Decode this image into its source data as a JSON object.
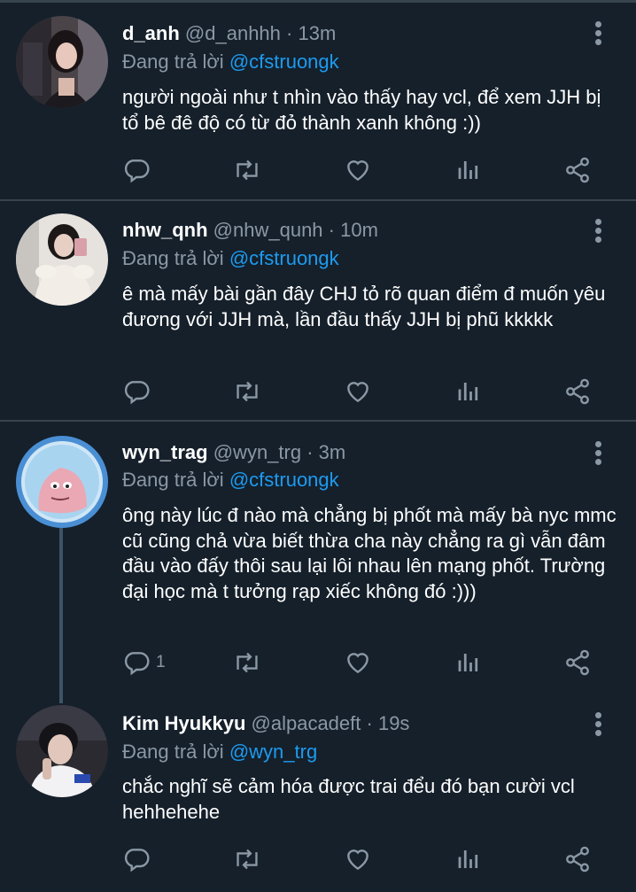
{
  "tweets": [
    {
      "name": "d_anh",
      "handle": "@d_anhhh",
      "separator": "·",
      "time": "13m",
      "replying_label": "Đang trả lời",
      "replying_to": "@cfstruongk",
      "text": "người ngoài như t nhìn vào thấy hay vcl, để xem JJH bị tổ bê đê độ có từ đỏ thành xanh không :))",
      "reply_count": ""
    },
    {
      "name": "nhw_qnh",
      "handle": "@nhw_qunh",
      "separator": "·",
      "time": "10m",
      "replying_label": "Đang trả lời",
      "replying_to": "@cfstruongk",
      "text": "ê mà mấy bài gần đây CHJ tỏ rõ quan điểm đ muốn yêu đương với JJH mà, lần đầu thấy JJH bị phũ kkkkk",
      "reply_count": ""
    },
    {
      "name": "wyn_trag",
      "handle": "@wyn_trg",
      "separator": "·",
      "time": "3m",
      "replying_label": "Đang trả lời",
      "replying_to": "@cfstruongk",
      "text": "ông này lúc đ nào mà chẳng bị phốt mà mấy bà nyc mmc cũ cũng chả vừa biết thừa cha này chẳng ra gì vẫn đâm đầu vào đấy thôi sau lại lôi nhau lên mạng phốt. Trường đại học mà t tưởng rạp xiếc không đó :)))",
      "reply_count": "1"
    },
    {
      "name": "Kim Hyukkyu",
      "handle": "@alpacadeft",
      "separator": "·",
      "time": "19s",
      "replying_label": "Đang trả lời",
      "replying_to": "@wyn_trg",
      "text": "chắc nghĩ sẽ cảm hóa được trai đểu đó bạn cười vcl hehhehehe",
      "reply_count": ""
    }
  ],
  "icons": {
    "reply": "reply-icon",
    "retweet": "retweet-icon",
    "like": "heart-icon",
    "analytics": "analytics-icon",
    "share": "share-icon",
    "more": "more-vertical-icon"
  },
  "colors": {
    "background": "#15202b",
    "divider": "#38444d",
    "secondary_text": "#8b98a5",
    "mention": "#1d9bf0",
    "primary_text": "#ffffff"
  }
}
